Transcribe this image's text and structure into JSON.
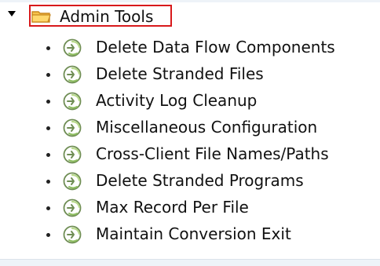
{
  "tree": {
    "root": {
      "label": "Admin Tools",
      "icon": "folder-icon",
      "expanded": true
    },
    "children": [
      {
        "label": "Delete Data Flow Components",
        "icon": "transaction-icon"
      },
      {
        "label": "Delete Stranded Files",
        "icon": "transaction-icon"
      },
      {
        "label": "Activity Log Cleanup",
        "icon": "transaction-icon"
      },
      {
        "label": "Miscellaneous Configuration",
        "icon": "transaction-icon"
      },
      {
        "label": "Cross-Client File Names/Paths",
        "icon": "transaction-icon"
      },
      {
        "label": "Delete Stranded Programs",
        "icon": "transaction-icon"
      },
      {
        "label": "Max Record Per File",
        "icon": "transaction-icon"
      },
      {
        "label": "Maintain Conversion Exit",
        "icon": "transaction-icon"
      }
    ]
  },
  "colors": {
    "selection_border": "#d8191b",
    "folder_fill": "#f6c24b",
    "folder_stroke": "#c8871e",
    "icon_stroke": "#6f8d54",
    "icon_fill": "#b8d98c"
  }
}
